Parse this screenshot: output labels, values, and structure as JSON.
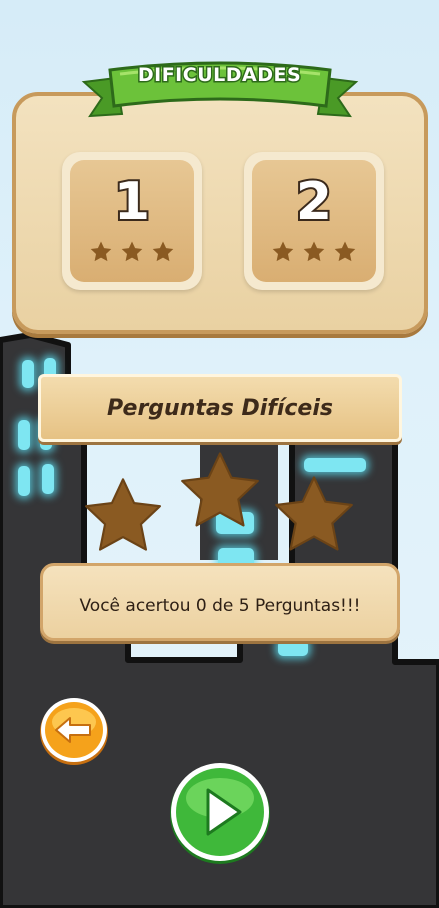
{
  "header": {
    "title": "DIFICULDADES"
  },
  "levels": [
    {
      "number": "1",
      "stars_earned": 3
    },
    {
      "number": "2",
      "stars_earned": 3
    }
  ],
  "result": {
    "category_title": "Perguntas Difíceis",
    "stars_earned": 3,
    "message": "Você acertou 0 de 5 Perguntas!!!"
  },
  "buttons": {
    "back": "back-arrow-icon",
    "play": "play-icon"
  },
  "colors": {
    "panel": "#f3e2bf",
    "star": "#8a5a22",
    "ribbon": "#6cc23a",
    "play": "#3fb83a",
    "back": "#f5a21b",
    "city": "#353537"
  }
}
